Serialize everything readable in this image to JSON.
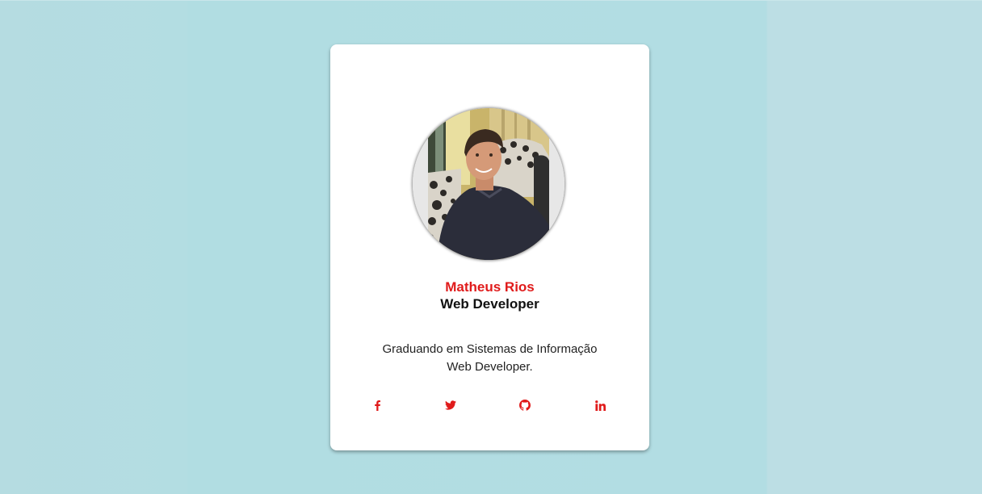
{
  "profile": {
    "name": "Matheus Rios",
    "role": "Web Developer",
    "bio_lines": [
      "Graduando em Sistemas de Informação",
      "Web Developer."
    ]
  },
  "socials": [
    {
      "icon": "facebook-icon"
    },
    {
      "icon": "twitter-icon"
    },
    {
      "icon": "github-icon"
    },
    {
      "icon": "linkedin-icon"
    }
  ],
  "colors": {
    "background": "#b3dde2",
    "card": "#ffffff",
    "accent": "#e01b1b",
    "text": "#111111"
  }
}
